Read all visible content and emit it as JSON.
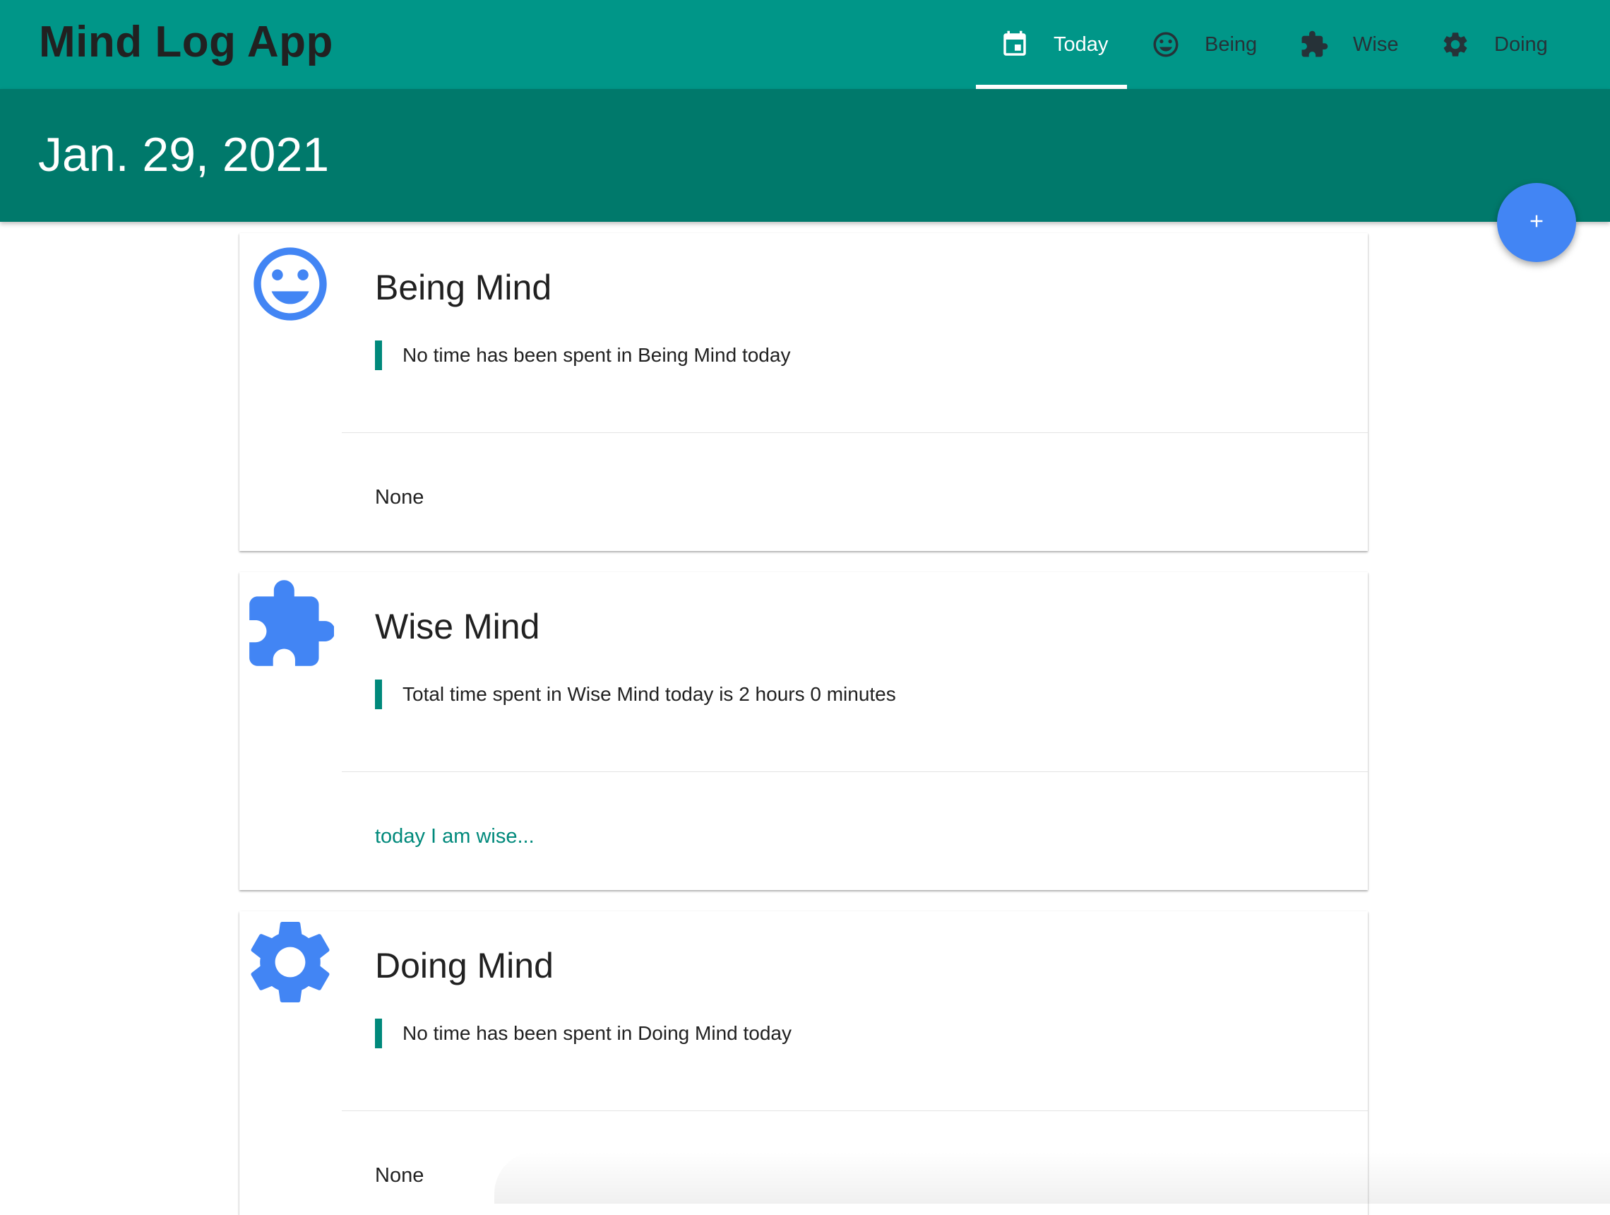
{
  "app": {
    "title": "Mind Log App"
  },
  "nav": {
    "tabs": [
      {
        "label": "Today",
        "icon": "calendar-icon",
        "active": true
      },
      {
        "label": "Being",
        "icon": "smiley-icon",
        "active": false
      },
      {
        "label": "Wise",
        "icon": "puzzle-icon",
        "active": false
      },
      {
        "label": "Doing",
        "icon": "gear-icon",
        "active": false
      }
    ]
  },
  "header": {
    "date": "Jan. 29, 2021"
  },
  "fab": {
    "icon": "plus-icon"
  },
  "cards": [
    {
      "title": "Being Mind",
      "icon": "smiley-icon",
      "stat": "No time has been spent in Being Mind today",
      "note": "None"
    },
    {
      "title": "Wise Mind",
      "icon": "puzzle-icon",
      "stat": "Total time spent in Wise Mind today is 2 hours 0 minutes",
      "note": "today I am wise..."
    },
    {
      "title": "Doing Mind",
      "icon": "gear-icon",
      "stat": "No time has been spent in Doing Mind today",
      "note": "None"
    }
  ],
  "colors": {
    "topbar": "#009688",
    "subbar": "#00796b",
    "accent_blue": "#4285f4",
    "stat_bar": "#00897b",
    "link": "#00897b"
  }
}
